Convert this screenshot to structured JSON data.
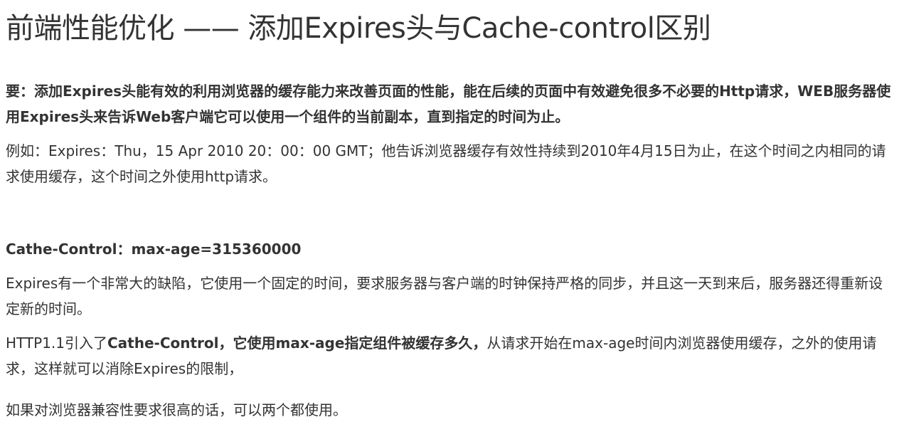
{
  "article": {
    "title": "前端性能优化 —— 添加Expires头与Cache-control区别",
    "intro": "要：添加Expires头能有效的利用浏览器的缓存能力来改善页面的性能，能在后续的页面中有效避免很多不必要的Http请求，WEB服务器使用Expires头来告诉Web客户端它可以使用一个组件的当前副本，直到指定的时间为止。",
    "example": "例如：Expires：Thu，15 Apr  2010  20：00：00  GMT；他告诉浏览器缓存有效性持续到2010年4月15日为止，在这个时间之内相同的请求使用缓存，这个时间之外使用http请求。",
    "cache_heading": "Cathe-Control：max-age=315360000",
    "drawback": "Expires有一个非常大的缺陷，它使用一个固定的时间，要求服务器与客户端的时钟保持严格的同步，并且这一天到来后，服务器还得重新设定新的时间。",
    "http11": {
      "prefix": "HTTP1.1引入了",
      "emphasis": "Cathe-Control，它使用max-age指定组件被缓存多久，",
      "suffix": "从请求开始在max-age时间内浏览器使用缓存，之外的使用请求，这样就可以消除Expires的限制，"
    },
    "both": "如果对浏览器兼容性要求很高的话，可以两个都使用。"
  }
}
